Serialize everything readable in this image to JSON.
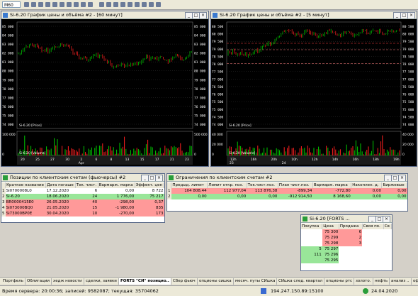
{
  "toolbar": {
    "period": "M60"
  },
  "chart1": {
    "title": "Si-6.20 График цены и объёма #2 - [60 минут]",
    "price_ticks": [
      "85 000",
      "84 000",
      "83 000",
      "82 000",
      "81 000",
      "80 000",
      "79 000",
      "78 000",
      "77 000",
      "76 000",
      "75 000",
      "74 000"
    ],
    "vol_ticks": [
      "500 000",
      "0"
    ],
    "vol_ticks_left": [
      "100 000",
      "0"
    ],
    "price_label": "Si-6.20 [Price]",
    "volume_label": "Si-6.20 [Volume]",
    "x_ticks": [
      "20",
      "25",
      "27",
      "30",
      "2",
      "6",
      "8",
      "13",
      "15",
      "17",
      "21",
      "23"
    ],
    "month": "Apr"
  },
  "chart2": {
    "title": "Si-6.20 График цены и объёма #2 - [5 минут]",
    "price_ticks": [
      "80 500",
      "80 000",
      "79 500",
      "79 000",
      "78 500",
      "78 000",
      "77 500",
      "77 000",
      "76 500",
      "76 000",
      "75 500",
      "75 000",
      "74 500",
      "74 000"
    ],
    "vol_ticks": [
      "40 000",
      "20 000",
      "0"
    ],
    "vol_ticks_left": [
      "40 000",
      "20 000",
      "0"
    ],
    "price_label": "Si-6.20 [Price]",
    "volume_label": "Si-6.20 [Volume]",
    "x_ticks": [
      "12h",
      "16h",
      "20h",
      "10h",
      "12h",
      "14h",
      "16h",
      "18h",
      "19h"
    ],
    "dates": [
      "23",
      "24"
    ]
  },
  "positions": {
    "title": "Позиции по клиентским счетам (фьючерсы) #2",
    "headers": [
      "",
      "Краткое название",
      "Дата погаше",
      "Тек. чист.",
      "Вармарж. марка",
      "Эффект. цен"
    ],
    "rows": [
      {
        "n": "1",
        "name": "Si0700008L0",
        "date": "17.12.2020",
        "qty": "6",
        "vm": "0,00",
        "price": "8 722",
        "color": "#ffffff"
      },
      {
        "n": "2",
        "name": "Si-6.20",
        "date": "18.06.2020",
        "qty": "24",
        "vm": "1 776,00",
        "price": "75 217",
        "color": "#99e699"
      },
      {
        "n": "3",
        "name": "BR0000415E0",
        "date": "26.05.2020",
        "qty": "40",
        "vm": "-298,00",
        "price": "0,37",
        "color": "#ff9999"
      },
      {
        "n": "4",
        "name": "Si073000BQ0",
        "date": "21.05.2020",
        "qty": "15",
        "vm": "-1 980,00",
        "price": "835",
        "color": "#ff9999"
      },
      {
        "n": "5",
        "name": "Si73000BP0E",
        "date": "30.04.2020",
        "qty": "10",
        "vm": "-270,00",
        "price": "173",
        "color": "#ff9999"
      }
    ]
  },
  "limits": {
    "title": "Ограничения по клиентским счетам #2",
    "headers": [
      "",
      "Предыд. лимит",
      "Лимит откр. поз.",
      "Тек.чист.поз.",
      "План чист.поз.",
      "Вармарж. марка",
      "Накоплен. д.",
      "Биржевые"
    ],
    "rows": [
      {
        "n": "1",
        "a": "104 808,44",
        "b": "112 977,04",
        "c": "113 876,38",
        "d": "-899,34",
        "e": "-772,80",
        "f": "0,00",
        "g": "0,00",
        "color": "#ff9999"
      },
      {
        "n": "2",
        "a": "0,00",
        "b": "0,00",
        "c": "0,00",
        "d": "-912 914,50",
        "e": "8 168,60",
        "f": "0,00",
        "g": "0,00",
        "color": "#99e699"
      }
    ]
  },
  "depth": {
    "title": "Si-6.20 [FORTS ...",
    "headers": [
      "Покупка",
      "Цена",
      "Продажа",
      "Своя по.",
      "Св"
    ],
    "rows": [
      {
        "buy": "",
        "price": "75 300",
        "sell": "6",
        "own": "",
        "type": "ask"
      },
      {
        "buy": "",
        "price": "75 299",
        "sell": "2",
        "own": "",
        "type": "ask"
      },
      {
        "buy": "",
        "price": "75 298",
        "sell": "3",
        "own": "",
        "type": "ask"
      },
      {
        "buy": "5",
        "price": "75 297",
        "sell": "",
        "own": "",
        "type": "bid"
      },
      {
        "buy": "111",
        "price": "75 296",
        "sell": "",
        "own": "",
        "type": "bid"
      },
      {
        "buy": "",
        "price": "75 295",
        "sell": "",
        "own": "",
        "type": "bid"
      }
    ]
  },
  "tabs": [
    "Портфель",
    "Облигации",
    "хедж новости",
    "сделки, заявки",
    "FORTS \"СИ\" позицио..",
    "Сбер фьюч",
    "опционы сишка",
    "месяч. путы СИшка",
    "СИшка след. квартал",
    "опционы ртс",
    "золото.",
    "нефть",
    "анализ ..",
    "офз фьючи"
  ],
  "status": {
    "server_time": "Время сервера: 20:00:36; записей: 9582087; текущая: 35704062",
    "ip": "194.247.150.89:15100",
    "date": "24.04.2020"
  },
  "colors": {
    "up": "#00cc00",
    "down": "#ff2020",
    "positive_row": "#99e699",
    "negative_row": "#ff9999"
  }
}
